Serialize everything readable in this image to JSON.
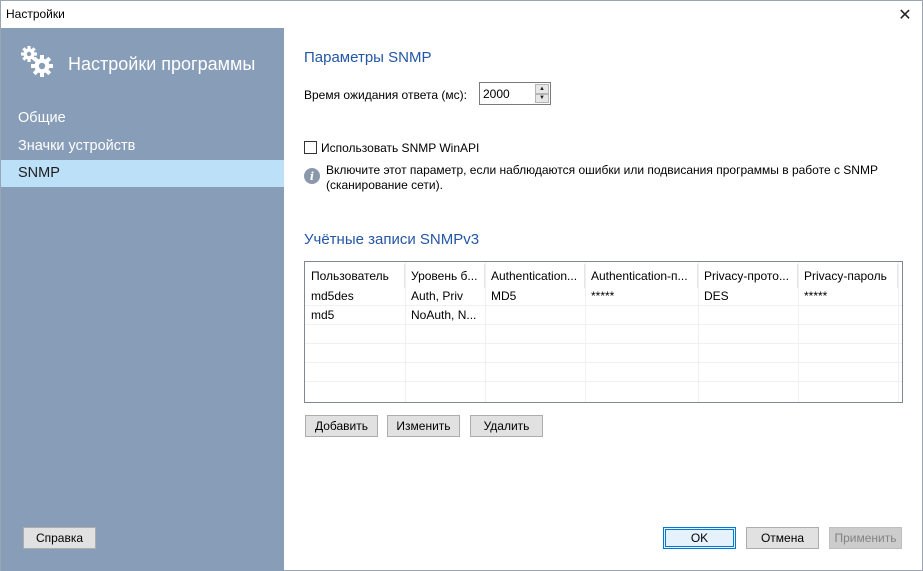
{
  "window": {
    "title": "Настройки"
  },
  "sidebar": {
    "header": "Настройки программы",
    "items": [
      {
        "label": "Общие",
        "active": false
      },
      {
        "label": "Значки устройств",
        "active": false
      },
      {
        "label": "SNMP",
        "active": true
      }
    ],
    "help_button": "Справка"
  },
  "snmp": {
    "section_title": "Параметры SNMP",
    "timeout_label": "Время ожидания ответа (мс):",
    "timeout_value": "2000",
    "winapi_checkbox_label": "Использовать SNMP WinAPI",
    "winapi_checked": false,
    "info_text_line1": "Включите этот параметр, если наблюдаются ошибки или подвисания программы в работе с SNMP",
    "info_text_line2": "(сканирование сети)."
  },
  "accounts": {
    "section_title": "Учётные записи SNMPv3",
    "columns": [
      "Пользователь",
      "Уровень б...",
      "Authentication...",
      "Authentication-п...",
      "Privacy-прото...",
      "Privacy-пароль"
    ],
    "rows": [
      [
        "md5des",
        "Auth, Priv",
        "MD5",
        "*****",
        "DES",
        "*****"
      ],
      [
        "md5",
        "NoAuth, N...",
        "",
        "",
        "",
        ""
      ]
    ],
    "add_button": "Добавить",
    "edit_button": "Изменить",
    "delete_button": "Удалить"
  },
  "footer": {
    "ok_button": "OK",
    "cancel_button": "Отмена",
    "apply_button": "Применить"
  },
  "colors": {
    "sidebar_bg": "#879db8",
    "sidebar_active_bg": "#bde0f9",
    "heading": "#2456a6",
    "accent": "#0078d7"
  }
}
